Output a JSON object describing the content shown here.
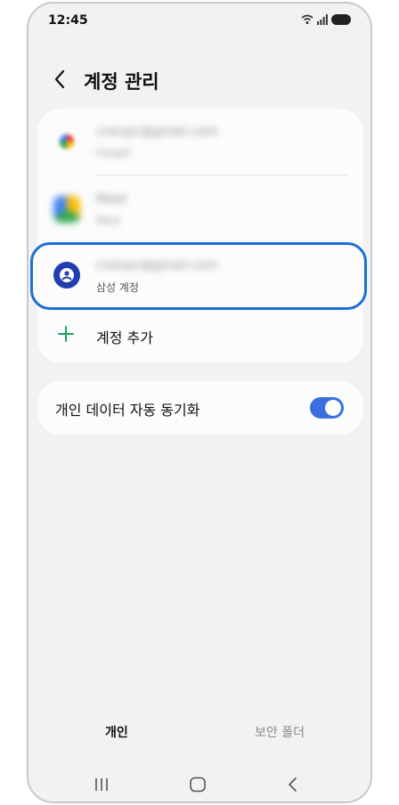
{
  "status_bar": {
    "time": "12:45"
  },
  "header": {
    "title": "계정 관리"
  },
  "accounts": [
    {
      "email": "cnecpc@gmail.com",
      "subtitle": "Google",
      "blurred": true,
      "icon": "google-icon"
    },
    {
      "email": "Meet",
      "subtitle": "Meet",
      "blurred": true,
      "icon": "drive-icon"
    },
    {
      "email": "cnecpc@gmail.com",
      "subtitle": "삼성 계정",
      "blurred": true,
      "icon": "samsung-account-icon",
      "highlighted": true
    }
  ],
  "add_account": {
    "label": "계정 추가"
  },
  "sync": {
    "label": "개인 데이터 자동 동기화",
    "enabled": true
  },
  "tabs": {
    "personal": "개인",
    "secure_folder": "보안 폴더"
  },
  "colors": {
    "accent": "#3b6fe0",
    "highlight": "#1b6fd6",
    "samsung_icon": "#1f3fb0",
    "plus": "#1aa35a"
  }
}
